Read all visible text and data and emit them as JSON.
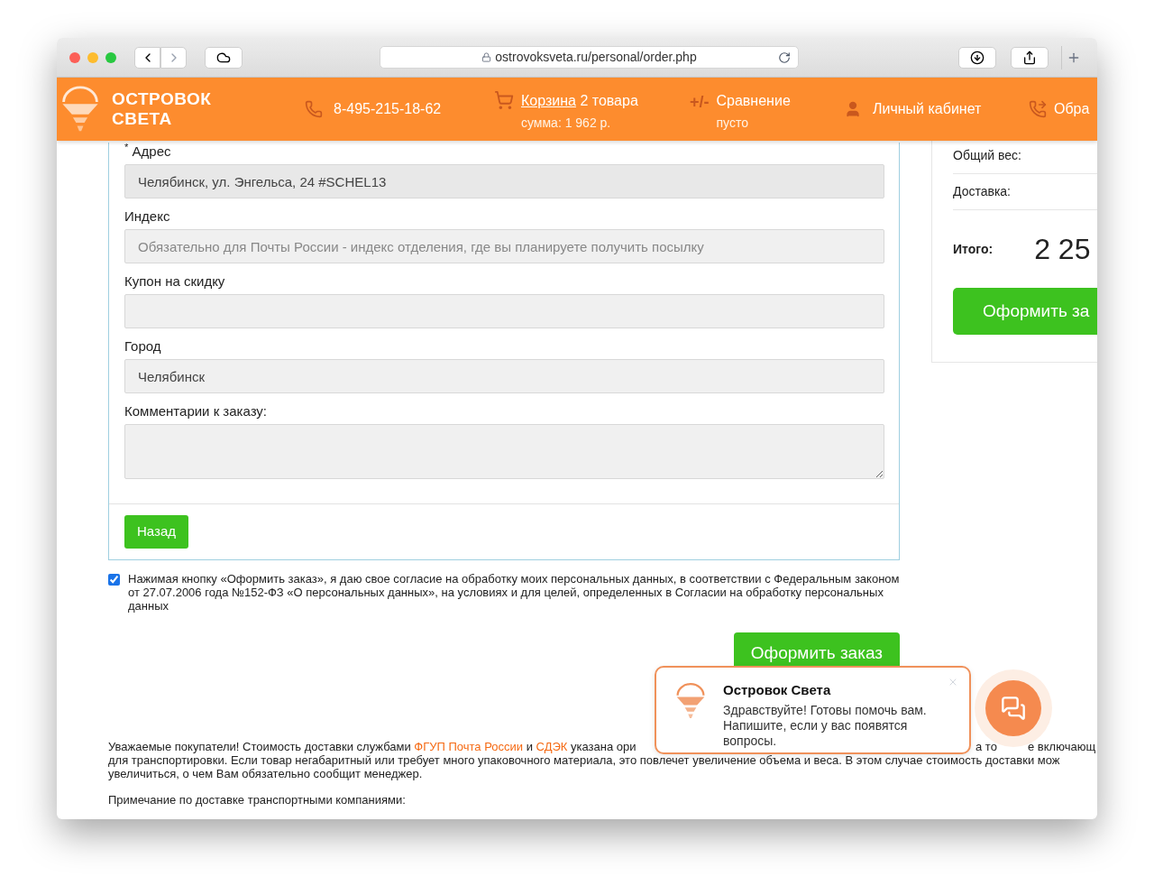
{
  "browser": {
    "url": "ostrovoksveta.ru/personal/order.php"
  },
  "header": {
    "logo": [
      "ОСТРОВОК",
      "СВЕТА"
    ],
    "phone": "8-495-215-18-62",
    "cart": {
      "link": "Корзина",
      "count": "2 товара",
      "sum": "сумма: 1 962 р."
    },
    "compare": {
      "sign": "+/-",
      "label": "Сравнение",
      "sub": "пусто"
    },
    "account": "Личный кабинет",
    "callback": "Обра"
  },
  "form": {
    "fields": [
      {
        "label": "Адрес",
        "mark": "*",
        "kind": "input",
        "value": "Челябинск, ул. Энгельса, 24 #SCHEL13"
      },
      {
        "label": "Индекс",
        "kind": "input",
        "placeholder": "Обязательно для Почты России - индекс отделения, где вы планируете получить посылку"
      },
      {
        "label": "Купон на скидку",
        "kind": "input"
      },
      {
        "label": "Город",
        "kind": "input",
        "value": "Челябинск"
      },
      {
        "label": "Комментарии к заказу:",
        "kind": "textarea"
      }
    ],
    "back_button": "Назад"
  },
  "consent": {
    "checked": true,
    "text": "Нажимая кнопку «Оформить заказ», я даю свое согласие на обработку моих персональных данных, в соответствии с Федеральным законом от 27.07.2006 года №152-ФЗ «О персональных данных», на условиях и для целей, определенных в Согласии на обработку персональных данных"
  },
  "submit_button": "Оформить заказ",
  "notice": {
    "line_1": {
      "before": "Уважаемые покупатели! Стоимость доставки службами ",
      "link_1": "ФГУП Почта России",
      "middle": " и ",
      "link_2": "СДЭК",
      "after": " указана ори",
      "right_1": "а то",
      "right_2": "е включающ"
    },
    "line_2": "для транспортировки. Если товар негабаритный или требует много упаковочного материала, это повлечет увеличение объема и веса. В этом случае стоимость доставки мож",
    "line_3": "увеличиться, о чем Вам обязательно сообщит менеджер.",
    "note": "Примечание по доставке транспортными компаниями:"
  },
  "summary": {
    "rows": [
      "Общий вес:",
      "Доставка:"
    ],
    "total_label": "Итого:",
    "total": "2 25",
    "button": "Оформить за"
  },
  "chat": {
    "title": "Островок Света",
    "message": "Здравствуйте! Готовы помочь вам. Напишите, если у вас появятся вопросы."
  }
}
